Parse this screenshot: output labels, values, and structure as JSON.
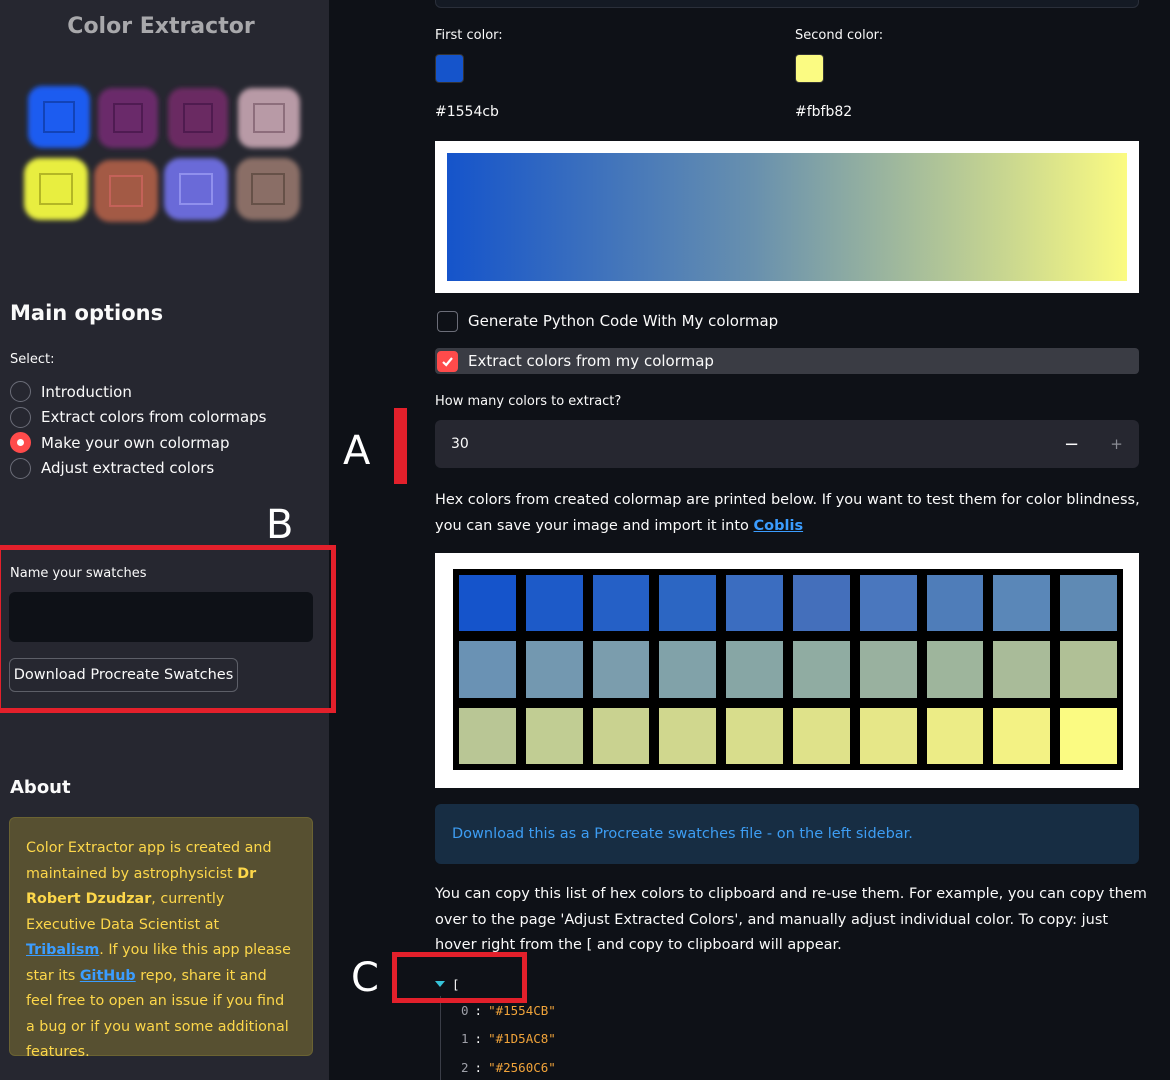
{
  "sidebar": {
    "app_title": "Color Extractor",
    "main_options_heading": "Main options",
    "select_label": "Select:",
    "radio_options": [
      {
        "label": "Introduction",
        "selected": false
      },
      {
        "label": "Extract colors from colormaps",
        "selected": false
      },
      {
        "label": "Make your own colormap",
        "selected": true
      },
      {
        "label": "Adjust extracted colors",
        "selected": false
      }
    ],
    "swatch_name_label": "Name your swatches",
    "swatch_name_value": "",
    "download_button": "Download Procreate Swatches",
    "about_heading": "About",
    "about": {
      "t1": "Color Extractor app is created and maintained by astrophysicist ",
      "name": "Dr Robert Dzudzar",
      "t2": ", currently Executive Data Scientist at ",
      "link1": "Tribalism",
      "t3": ". If you like this app please star its ",
      "link2": "GitHub",
      "t4": " repo, share it and feel free to open an issue if you find a bug or if you want some additional features."
    }
  },
  "main": {
    "first_color_label": "First color:",
    "second_color_label": "Second color:",
    "first_color_hex": "#1554cb",
    "second_color_hex": "#fbfb82",
    "checkbox_python": {
      "label": "Generate Python Code With My colormap",
      "checked": false
    },
    "checkbox_extract": {
      "label": "Extract colors from my colormap",
      "checked": true
    },
    "num_colors_label": "How many colors to extract?",
    "num_colors_value": "30",
    "minus_label": "−",
    "plus_label": "+",
    "hex_paragraph_text": "Hex colors from created colormap are printed below. If you want to test them for color blindness, you can save your image and import it into ",
    "hex_paragraph_link": "Coblis",
    "swatches": [
      "#1554cb",
      "#1d5ac8",
      "#2560c6",
      "#2c66c3",
      "#3b6dc0",
      "#446fbb",
      "#4a77be",
      "#4f7db9",
      "#5a87b8",
      "#5f8ab4",
      "#6a92b4",
      "#7398b0",
      "#7b9dad",
      "#81a2a9",
      "#87a6a5",
      "#90aca2",
      "#99b19f",
      "#9eb59c",
      "#a9bb99",
      "#b0c096",
      "#b9c695",
      "#c1cd93",
      "#c9d290",
      "#d0d78e",
      "#d8dd8c",
      "#dfe28a",
      "#e6e788",
      "#ecec86",
      "#f3f284",
      "#fbfb82"
    ],
    "info_box_text": "Download this as a Procreate swatches file - on the left sidebar.",
    "copy_paragraph": "You can copy this list of hex colors to clipboard and re-use them. For example, you can copy them over to the page 'Adjust Extracted Colors', and manually adjust individual color. To copy: just hover right from the [ and copy to clipboard will appear.",
    "json_open_bracket": "[",
    "json_items": [
      {
        "index": "0",
        "value": "\"#1554CB\""
      },
      {
        "index": "1",
        "value": "\"#1D5AC8\""
      },
      {
        "index": "2",
        "value": "\"#2560C6\""
      }
    ]
  },
  "annotations": {
    "label_a": "A",
    "label_b": "B",
    "label_c": "C"
  }
}
